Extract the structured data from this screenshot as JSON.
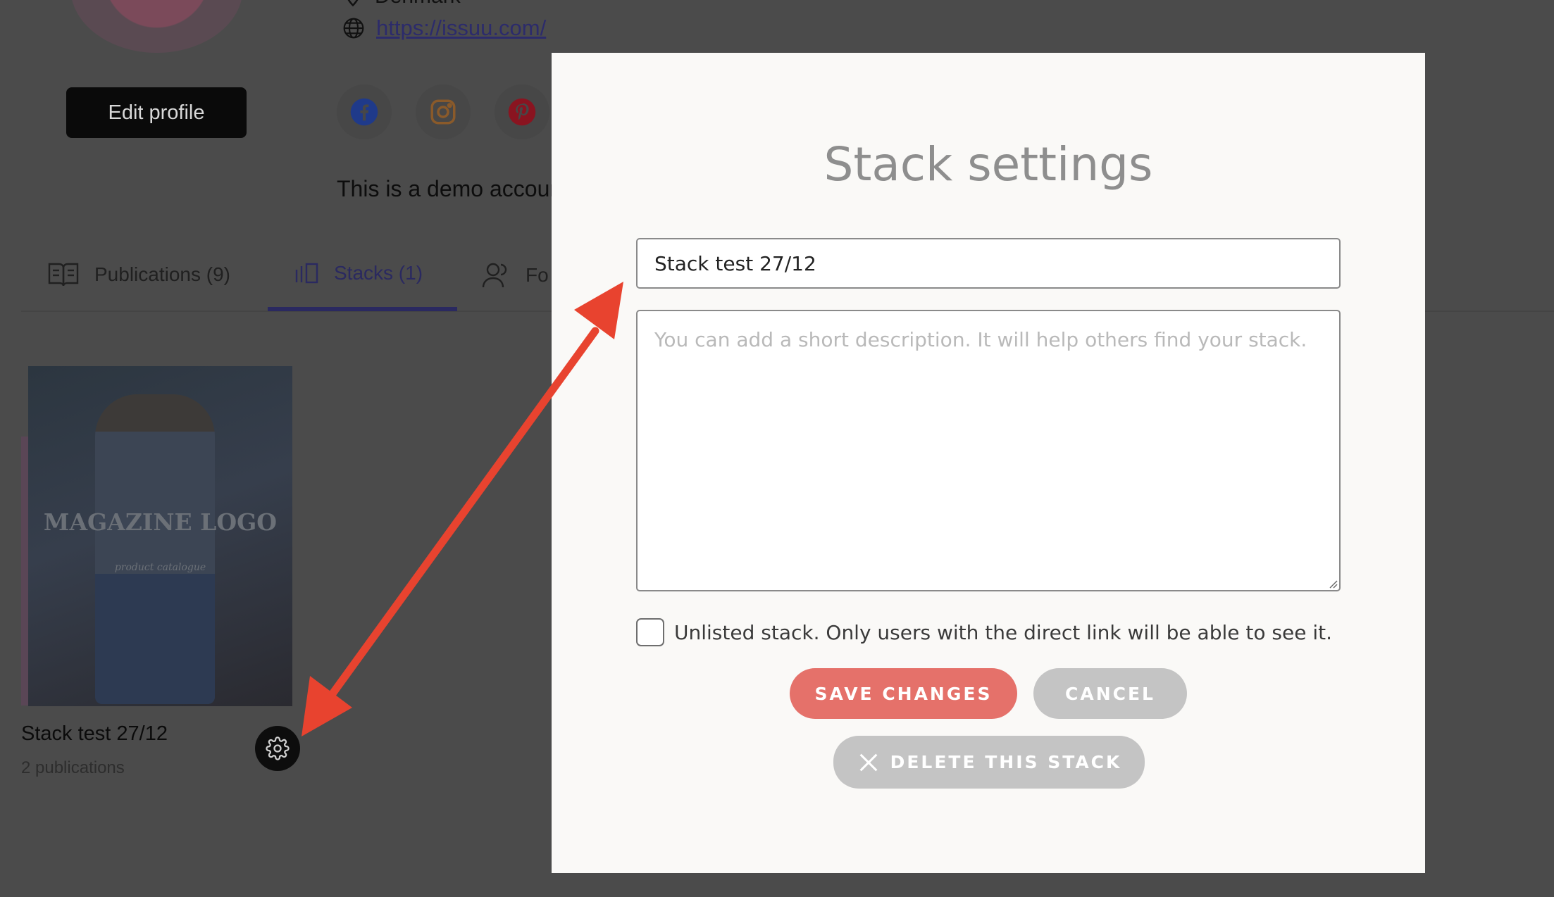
{
  "profile": {
    "location": "Denmark",
    "website": "https://issuu.com/",
    "edit_label": "Edit profile",
    "bio": "This is a demo account",
    "social": [
      "facebook-icon",
      "instagram-icon",
      "pinterest-icon"
    ]
  },
  "tabs": [
    {
      "label": "Publications (9)",
      "icon": "book-icon"
    },
    {
      "label": "Stacks (1)",
      "icon": "stacks-icon",
      "active": true
    },
    {
      "label": "Fo",
      "icon": "followers-icon"
    }
  ],
  "stack": {
    "cover_title": "MAGAZINE LOGO",
    "cover_subtitle": "product catalogue",
    "title": "Stack test 27/12",
    "count": "2 publications"
  },
  "modal": {
    "title": "Stack settings",
    "name_value": "Stack test 27/12",
    "description_placeholder": "You can add a short description. It will help others find your stack.",
    "unlisted_label": "Unlisted stack. Only users with the direct link will be able to see it.",
    "unlisted_checked": false,
    "save_label": "SAVE CHANGES",
    "cancel_label": "CANCEL",
    "delete_label": "DELETE THIS STACK"
  },
  "colors": {
    "overlay": "#4b4b4b",
    "modal_bg": "#faf9f7",
    "save": "#e5716a",
    "neutral_button": "#c4c4c4",
    "accent_tab": "#2a2960",
    "annotation_arrow": "#e8432f"
  }
}
